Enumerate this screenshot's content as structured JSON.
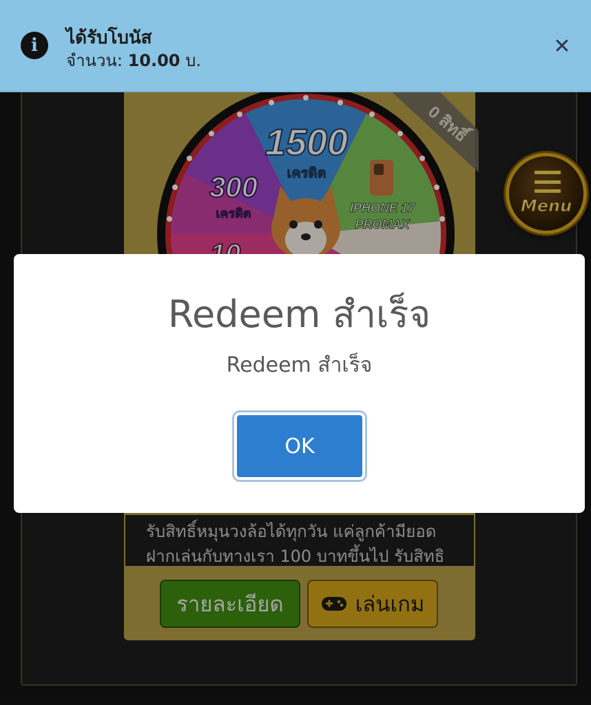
{
  "notification": {
    "icon": "info-icon",
    "title": "ได้รับโบนัส",
    "amount_label": "จำนวน:",
    "amount_value": "10.00",
    "currency": "บ.",
    "close_icon": "close-icon"
  },
  "wheel": {
    "banner_text": "0 สิทธิ์",
    "segments": [
      {
        "value": "1500",
        "unit": "เครดิต",
        "color": "#3f8fd8"
      },
      {
        "value": "300",
        "unit": "เครดิต",
        "color": "#9a43c4"
      },
      {
        "value": "IPHONE 17",
        "unit": "PROMAX",
        "color": "#7cc05a"
      },
      {
        "value": "10",
        "unit": "",
        "color": "#e0408a"
      }
    ]
  },
  "menu_button": {
    "label": "Menu"
  },
  "modal": {
    "title": "Redeem สำเร็จ",
    "message": "Redeem สำเร็จ",
    "ok_label": "OK"
  },
  "description": {
    "line1": "รับสิทธิ์หมุนวงล้อได้ทุกวัน แค่ลูกค้ามียอด",
    "line2": "ฝากเล่นกับทางเรา 100 บาทขึ้นไป รับสิทธิ"
  },
  "actions": {
    "details_label": "รายละเอียด",
    "play_label": "เล่นเกม",
    "play_icon": "gamepad-icon"
  },
  "colors": {
    "toast_bg": "#89c4e4",
    "ok_button": "#2e7ed0",
    "details_button": "#3f8a10",
    "play_button": "#d1a31a"
  }
}
